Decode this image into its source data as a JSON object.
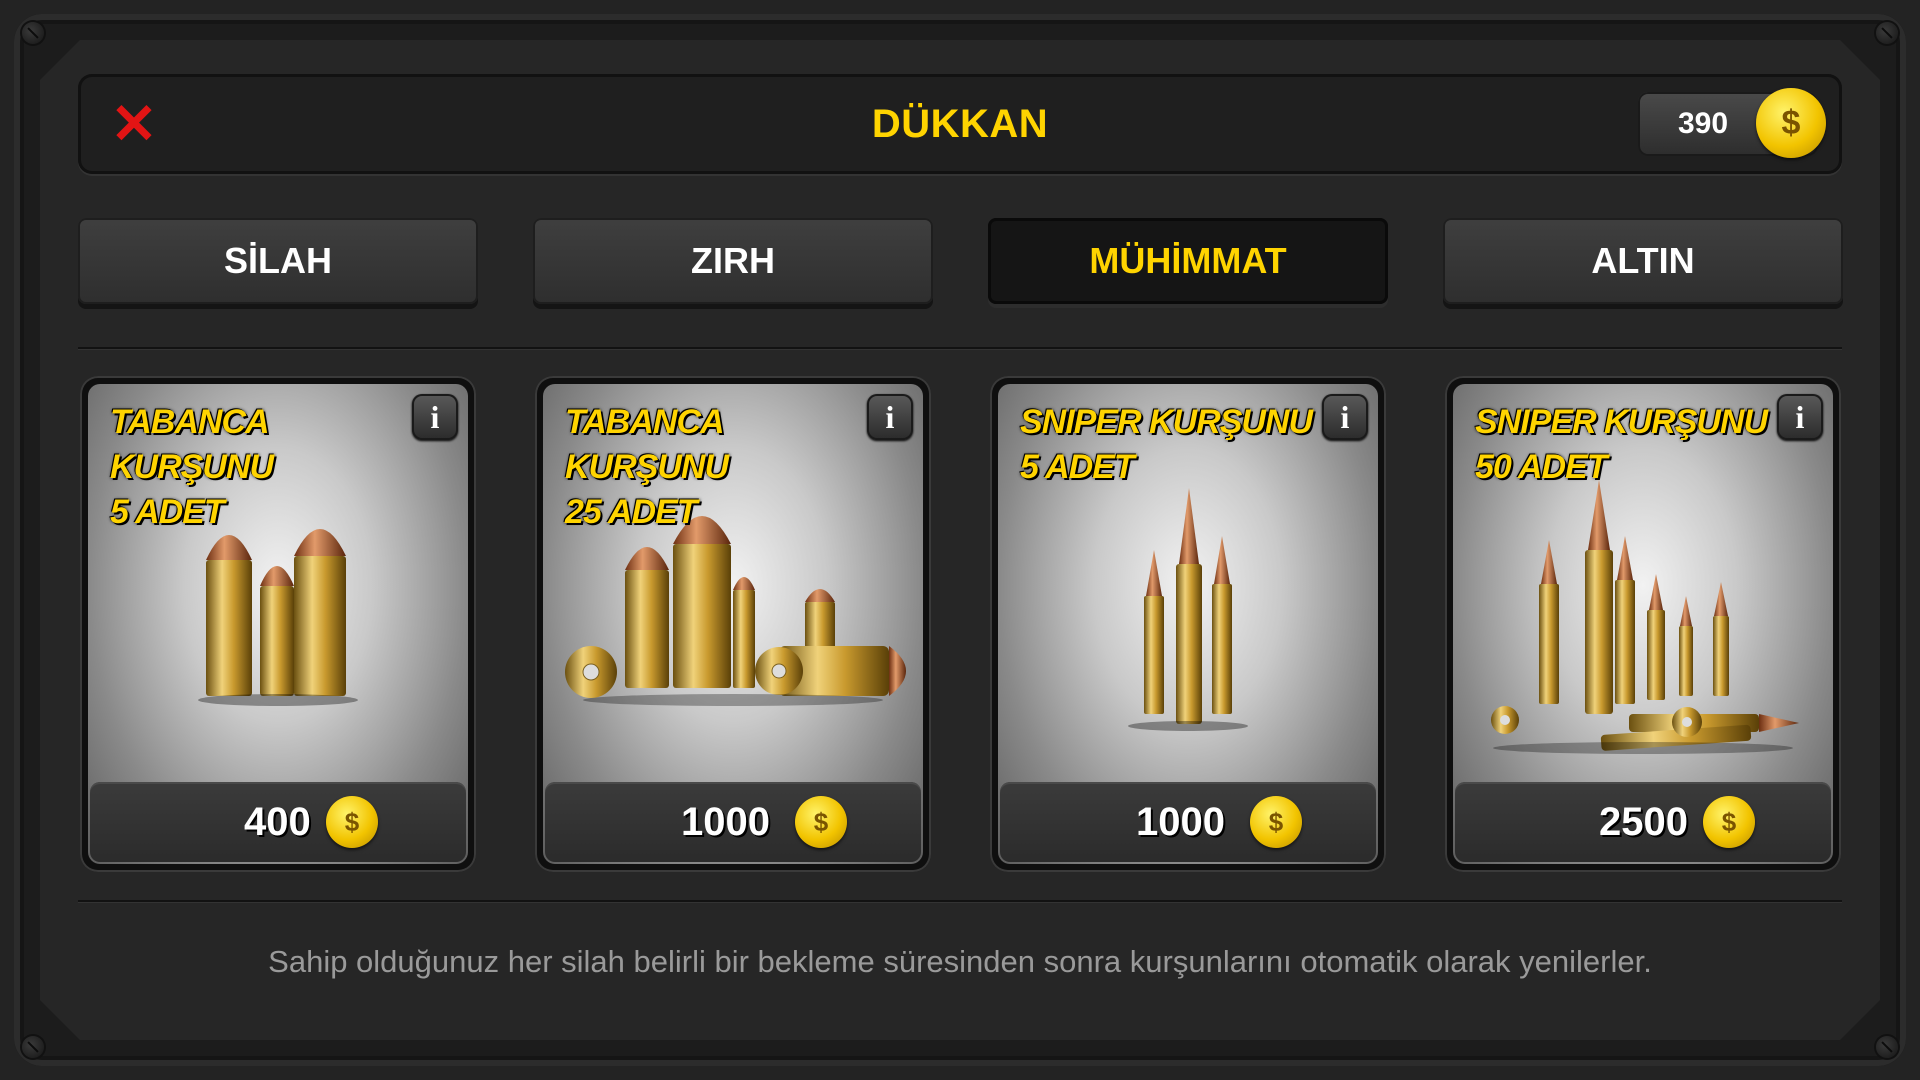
{
  "header": {
    "title": "DÜKKAN",
    "close_icon": "close-x-icon",
    "balance": "390",
    "coin_symbol": "$"
  },
  "tabs": [
    {
      "label": "SİLAH",
      "active": false
    },
    {
      "label": "ZIRH",
      "active": false
    },
    {
      "label": "MÜHİMMAT",
      "active": true
    },
    {
      "label": "ALTIN",
      "active": false
    }
  ],
  "items": [
    {
      "name_line1": "TABANCA KURŞUNU",
      "name_line2": "5 ADET",
      "price": "400",
      "icon": "pistol-bullets-small-icon"
    },
    {
      "name_line1": "TABANCA KURŞUNU",
      "name_line2": "25 ADET",
      "price": "1000",
      "icon": "pistol-bullets-pile-icon"
    },
    {
      "name_line1": "SNIPER KURŞUNU",
      "name_line2": "5 ADET",
      "price": "1000",
      "icon": "sniper-bullets-small-icon"
    },
    {
      "name_line1": "SNIPER KURŞUNU",
      "name_line2": "50 ADET",
      "price": "2500",
      "icon": "sniper-bullets-pile-icon"
    }
  ],
  "info_label": "i",
  "footer": {
    "note": "Sahip olduğunuz her silah belirli bir bekleme süresinden sonra kurşunlarını otomatik olarak yenilerler."
  },
  "colors": {
    "accent": "#ffd400",
    "close": "#e31414",
    "coin": "#f2c400"
  }
}
